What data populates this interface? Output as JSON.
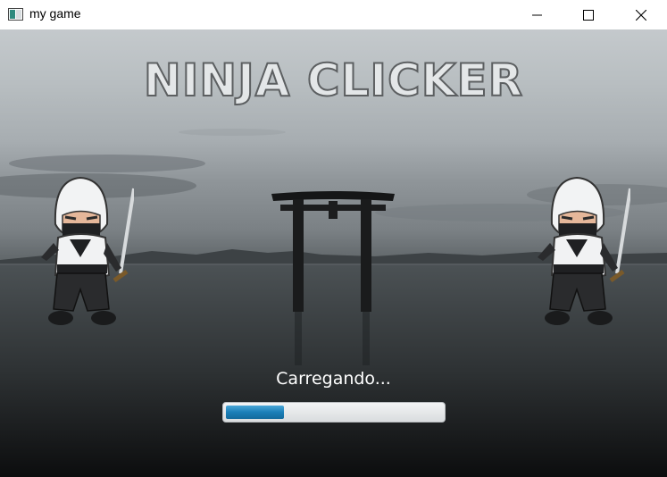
{
  "window": {
    "title": "my game",
    "icon": "app-window-icon"
  },
  "game": {
    "title": "NINJA CLICKER",
    "loading_text": "Carregando...",
    "progress": 0.27,
    "accent_color": "#1b7fb8"
  }
}
